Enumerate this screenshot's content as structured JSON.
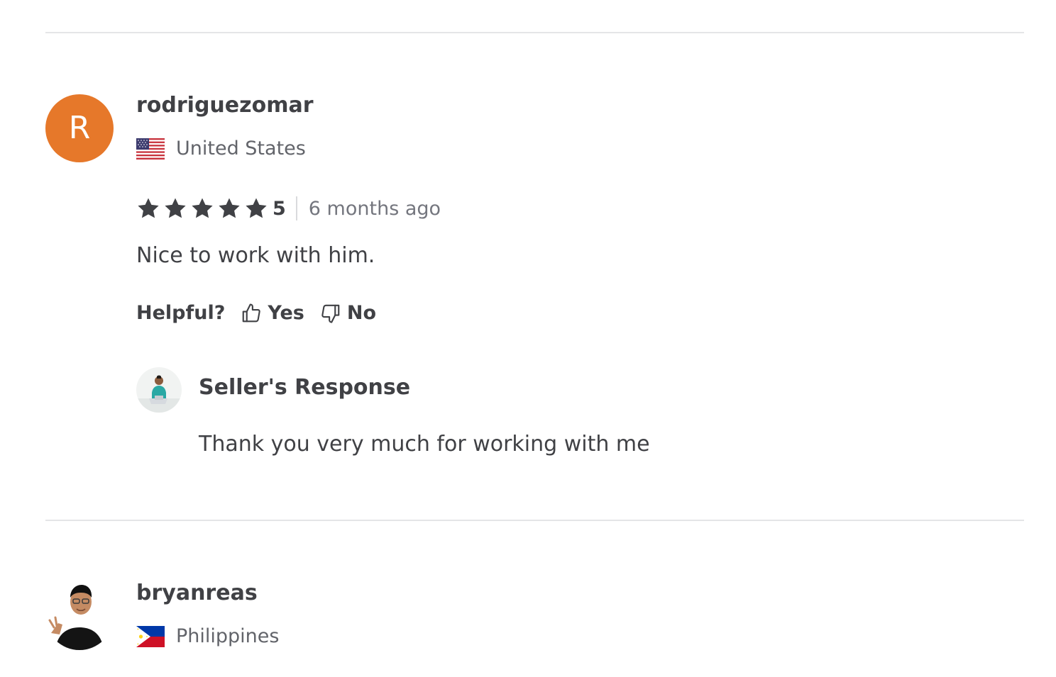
{
  "reviews": [
    {
      "avatar_letter": "R",
      "avatar_color": "#e6782a",
      "username": "rodriguezomar",
      "country": "United States",
      "country_flag": "us-flag",
      "rating": 5,
      "rating_label": "5",
      "time_ago": "6 months ago",
      "comment": "Nice to work with him.",
      "helpful": {
        "label": "Helpful?",
        "yes_label": "Yes",
        "no_label": "No"
      },
      "seller_response": {
        "title": "Seller's Response",
        "text": "Thank you very much for working with me"
      }
    },
    {
      "avatar_icon": "user-photo-avatar",
      "username": "bryanreas",
      "country": "Philippines",
      "country_flag": "ph-flag"
    }
  ],
  "colors": {
    "accent_avatar": "#e6782a",
    "text_primary": "#404145",
    "text_secondary": "#62646a",
    "divider": "#e4e5e7"
  }
}
